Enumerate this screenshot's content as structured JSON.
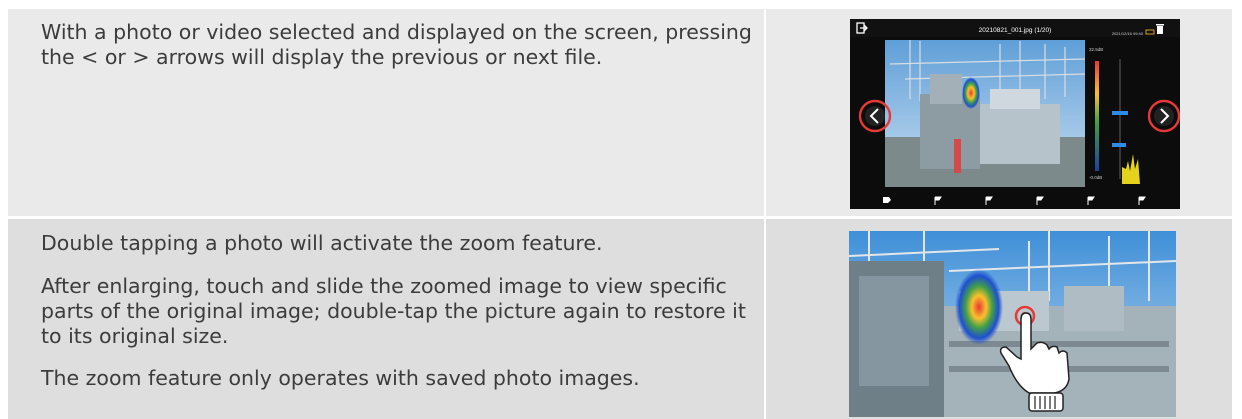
{
  "row1": {
    "text": "With a photo or video selected and displayed on the screen, pressing the < or > arrows will display the previous or next file.",
    "thumbnail": {
      "file_title": "20210821_001.jpg (1/20)",
      "status": "2021/12/16 09:40",
      "prev_arrow_icon": "chevron-left-icon",
      "next_arrow_icon": "chevron-right-icon",
      "back_icon": "exit-icon",
      "delete_icon": "trash-icon",
      "scale_max": "32.5dB",
      "scale_min": "-0.0dB",
      "highlight_color": "#e53935"
    }
  },
  "row2": {
    "paragraphs": [
      "Double tapping a photo will activate the zoom feature.",
      "After enlarging, touch and slide the zoomed image to view specific parts of the original image; double-tap the picture again to restore it to its original size.",
      "The zoom feature only operates with saved photo images."
    ],
    "thumbnail": {
      "gesture_icon": "hand-tap-icon"
    }
  }
}
